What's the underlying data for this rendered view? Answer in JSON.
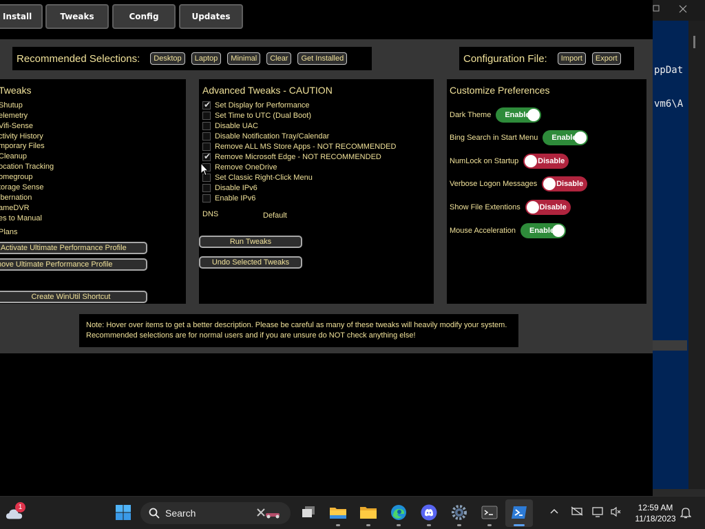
{
  "tabs": {
    "install": "Install",
    "tweaks": "Tweaks",
    "config": "Config",
    "updates": "Updates"
  },
  "recommended": {
    "title": "Recommended Selections:",
    "buttons": [
      "Desktop",
      "Laptop",
      "Minimal",
      "Clear",
      "Get Installed"
    ]
  },
  "config_file": {
    "title": "Configuration File:",
    "buttons": [
      "Import",
      "Export"
    ]
  },
  "essential": {
    "title": "Tweaks",
    "items": [
      "Shutup",
      "elemetry",
      "Vifi-Sense",
      "ctivity History",
      "mporary Files",
      "Cleanup",
      "ocation Tracking",
      "omegroup",
      "torage Sense",
      "ibernation",
      "ameDVR",
      "es to Manual"
    ],
    "plans_label": "Plans",
    "btn_activate": "l Activate Ultimate Performance Profile",
    "btn_remove": "nove Ultimate Performance Profile",
    "btn_shortcut": "Create WinUtil Shortcut"
  },
  "advanced": {
    "title": "Advanced Tweaks - CAUTION",
    "items": [
      {
        "label": "Set Display for Performance",
        "checked": true
      },
      {
        "label": "Set Time to UTC (Dual Boot)",
        "checked": false
      },
      {
        "label": "Disable UAC",
        "checked": false
      },
      {
        "label": "Disable Notification Tray/Calendar",
        "checked": false
      },
      {
        "label": "Remove ALL MS Store Apps - NOT RECOMMENDED",
        "checked": false
      },
      {
        "label": "Remove Microsoft Edge - NOT RECOMMENDED",
        "checked": true
      },
      {
        "label": "Remove OneDrive",
        "checked": false
      },
      {
        "label": "Set Classic Right-Click Menu",
        "checked": false
      },
      {
        "label": "Disable IPv6",
        "checked": false
      },
      {
        "label": "Enable IPv6",
        "checked": false
      }
    ],
    "dns_label": "DNS",
    "dns_value": "Default",
    "run_btn": "Run Tweaks",
    "undo_btn": "Undo Selected Tweaks"
  },
  "preferences": {
    "title": "Customize Preferences",
    "items": [
      {
        "label": "Dark Theme",
        "state": "Enable"
      },
      {
        "label": "Bing Search in Start Menu",
        "state": "Enable"
      },
      {
        "label": "NumLock on Startup",
        "state": "Disable"
      },
      {
        "label": "Verbose Logon Messages",
        "state": "Disable"
      },
      {
        "label": "Show File Extentions",
        "state": "Disable"
      },
      {
        "label": "Mouse Acceleration",
        "state": "Enable"
      }
    ]
  },
  "note": {
    "line1": "Note: Hover over items to get a better description. Please be careful as many of these tweaks will heavily modify your system.",
    "line2": "Recommended selections are for normal users and if you are unsure do NOT check anything else!"
  },
  "terminal": {
    "line1": "ppDat",
    "line2": "vm6\\A"
  },
  "taskbar": {
    "search_label": "Search",
    "notification_count": "1",
    "time": "12:59 AM",
    "date": "11/18/2023",
    "apps": [
      "start-icon",
      "search-icon",
      "task-view-icon",
      "file-explorer-icon",
      "folder-icon",
      "edge-icon",
      "discord-icon",
      "settings-icon",
      "terminal-icon",
      "powershell-icon"
    ]
  },
  "colors": {
    "accent_text": "#f1e29a",
    "toggle_on": "#2e8b3a",
    "toggle_off": "#b0243e",
    "window_bg": "#363636"
  }
}
